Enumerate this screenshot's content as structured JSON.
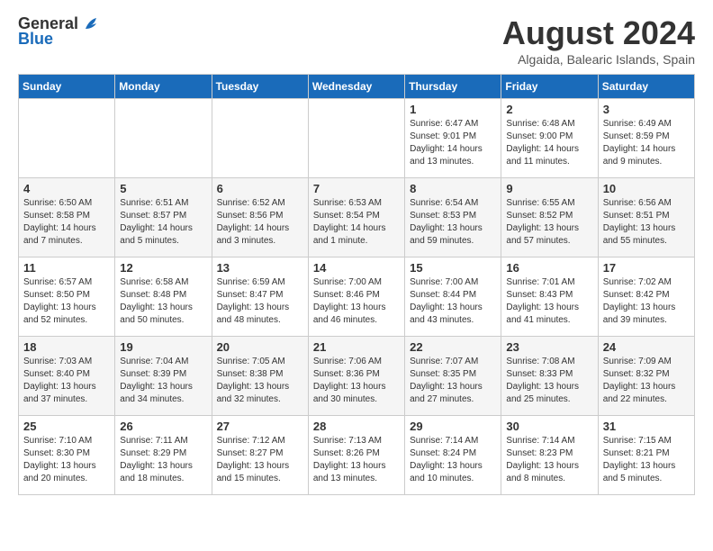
{
  "header": {
    "logo_general": "General",
    "logo_blue": "Blue",
    "month_year": "August 2024",
    "location": "Algaida, Balearic Islands, Spain"
  },
  "days_of_week": [
    "Sunday",
    "Monday",
    "Tuesday",
    "Wednesday",
    "Thursday",
    "Friday",
    "Saturday"
  ],
  "weeks": [
    [
      {
        "day": "",
        "content": ""
      },
      {
        "day": "",
        "content": ""
      },
      {
        "day": "",
        "content": ""
      },
      {
        "day": "",
        "content": ""
      },
      {
        "day": "1",
        "content": "Sunrise: 6:47 AM\nSunset: 9:01 PM\nDaylight: 14 hours\nand 13 minutes."
      },
      {
        "day": "2",
        "content": "Sunrise: 6:48 AM\nSunset: 9:00 PM\nDaylight: 14 hours\nand 11 minutes."
      },
      {
        "day": "3",
        "content": "Sunrise: 6:49 AM\nSunset: 8:59 PM\nDaylight: 14 hours\nand 9 minutes."
      }
    ],
    [
      {
        "day": "4",
        "content": "Sunrise: 6:50 AM\nSunset: 8:58 PM\nDaylight: 14 hours\nand 7 minutes."
      },
      {
        "day": "5",
        "content": "Sunrise: 6:51 AM\nSunset: 8:57 PM\nDaylight: 14 hours\nand 5 minutes."
      },
      {
        "day": "6",
        "content": "Sunrise: 6:52 AM\nSunset: 8:56 PM\nDaylight: 14 hours\nand 3 minutes."
      },
      {
        "day": "7",
        "content": "Sunrise: 6:53 AM\nSunset: 8:54 PM\nDaylight: 14 hours\nand 1 minute."
      },
      {
        "day": "8",
        "content": "Sunrise: 6:54 AM\nSunset: 8:53 PM\nDaylight: 13 hours\nand 59 minutes."
      },
      {
        "day": "9",
        "content": "Sunrise: 6:55 AM\nSunset: 8:52 PM\nDaylight: 13 hours\nand 57 minutes."
      },
      {
        "day": "10",
        "content": "Sunrise: 6:56 AM\nSunset: 8:51 PM\nDaylight: 13 hours\nand 55 minutes."
      }
    ],
    [
      {
        "day": "11",
        "content": "Sunrise: 6:57 AM\nSunset: 8:50 PM\nDaylight: 13 hours\nand 52 minutes."
      },
      {
        "day": "12",
        "content": "Sunrise: 6:58 AM\nSunset: 8:48 PM\nDaylight: 13 hours\nand 50 minutes."
      },
      {
        "day": "13",
        "content": "Sunrise: 6:59 AM\nSunset: 8:47 PM\nDaylight: 13 hours\nand 48 minutes."
      },
      {
        "day": "14",
        "content": "Sunrise: 7:00 AM\nSunset: 8:46 PM\nDaylight: 13 hours\nand 46 minutes."
      },
      {
        "day": "15",
        "content": "Sunrise: 7:00 AM\nSunset: 8:44 PM\nDaylight: 13 hours\nand 43 minutes."
      },
      {
        "day": "16",
        "content": "Sunrise: 7:01 AM\nSunset: 8:43 PM\nDaylight: 13 hours\nand 41 minutes."
      },
      {
        "day": "17",
        "content": "Sunrise: 7:02 AM\nSunset: 8:42 PM\nDaylight: 13 hours\nand 39 minutes."
      }
    ],
    [
      {
        "day": "18",
        "content": "Sunrise: 7:03 AM\nSunset: 8:40 PM\nDaylight: 13 hours\nand 37 minutes."
      },
      {
        "day": "19",
        "content": "Sunrise: 7:04 AM\nSunset: 8:39 PM\nDaylight: 13 hours\nand 34 minutes."
      },
      {
        "day": "20",
        "content": "Sunrise: 7:05 AM\nSunset: 8:38 PM\nDaylight: 13 hours\nand 32 minutes."
      },
      {
        "day": "21",
        "content": "Sunrise: 7:06 AM\nSunset: 8:36 PM\nDaylight: 13 hours\nand 30 minutes."
      },
      {
        "day": "22",
        "content": "Sunrise: 7:07 AM\nSunset: 8:35 PM\nDaylight: 13 hours\nand 27 minutes."
      },
      {
        "day": "23",
        "content": "Sunrise: 7:08 AM\nSunset: 8:33 PM\nDaylight: 13 hours\nand 25 minutes."
      },
      {
        "day": "24",
        "content": "Sunrise: 7:09 AM\nSunset: 8:32 PM\nDaylight: 13 hours\nand 22 minutes."
      }
    ],
    [
      {
        "day": "25",
        "content": "Sunrise: 7:10 AM\nSunset: 8:30 PM\nDaylight: 13 hours\nand 20 minutes."
      },
      {
        "day": "26",
        "content": "Sunrise: 7:11 AM\nSunset: 8:29 PM\nDaylight: 13 hours\nand 18 minutes."
      },
      {
        "day": "27",
        "content": "Sunrise: 7:12 AM\nSunset: 8:27 PM\nDaylight: 13 hours\nand 15 minutes."
      },
      {
        "day": "28",
        "content": "Sunrise: 7:13 AM\nSunset: 8:26 PM\nDaylight: 13 hours\nand 13 minutes."
      },
      {
        "day": "29",
        "content": "Sunrise: 7:14 AM\nSunset: 8:24 PM\nDaylight: 13 hours\nand 10 minutes."
      },
      {
        "day": "30",
        "content": "Sunrise: 7:14 AM\nSunset: 8:23 PM\nDaylight: 13 hours\nand 8 minutes."
      },
      {
        "day": "31",
        "content": "Sunrise: 7:15 AM\nSunset: 8:21 PM\nDaylight: 13 hours\nand 5 minutes."
      }
    ]
  ]
}
